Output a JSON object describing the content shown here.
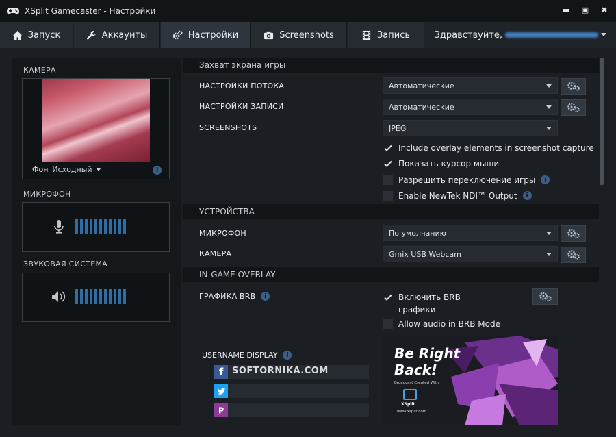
{
  "window": {
    "title": "XSplit Gamecaster - Настройки"
  },
  "tabs": [
    {
      "label": "Запуск",
      "icon": "home-icon"
    },
    {
      "label": "Аккаунты",
      "icon": "wrench-icon"
    },
    {
      "label": "Настройки",
      "icon": "gears-icon"
    },
    {
      "label": "Screenshots",
      "icon": "camera-icon"
    },
    {
      "label": "Запись",
      "icon": "film-icon"
    }
  ],
  "greeting": "Здравствуйте,",
  "left": {
    "camera_label": "КАМЕРА",
    "background_label": "Фон",
    "background_value": "Исходный",
    "mic_label": "МИКРОФОН",
    "speaker_label": "ЗВУКОВАЯ СИСТЕМА"
  },
  "capture": {
    "heading": "Захват экрана игры",
    "stream_label": "НАСТРОЙКИ ПОТОКА",
    "stream_value": "Автоматические",
    "record_label": "НАСТРОЙКИ ЗАПИСИ",
    "record_value": "Автоматические",
    "screenshots_label": "SCREENSHOTS",
    "screenshots_value": "JPEG",
    "checks": [
      {
        "label": "Include overlay elements in screenshot capture",
        "checked": true
      },
      {
        "label": "Показать курсор мыши",
        "checked": true
      },
      {
        "label": "Разрешить переключение игры",
        "checked": false
      },
      {
        "label": "Enable NewTek NDI™ Output",
        "checked": false
      }
    ]
  },
  "devices": {
    "heading": "УСТРОЙСТВА",
    "mic_label": "МИКРОФОН",
    "mic_value": "По умолчанию",
    "camera_label": "КАМЕРА",
    "camera_value": "Gmix USB Webcam"
  },
  "overlay": {
    "heading": "IN-GAME OVERLAY",
    "brb_label": "ГРАФИКА BRB",
    "brb_enable_line1": "Включить BRB",
    "brb_enable_line2": "графики",
    "brb_enable_checked": true,
    "allow_audio_label": "Allow audio in BRB Mode",
    "allow_audio_checked": false,
    "username_label": "USERNAME DISPLAY",
    "facebook_value": "SOFTORNIKA.COM",
    "twitter_value": "",
    "picarto_value": ""
  },
  "brb_preview": {
    "title_line1": "Be Right",
    "title_line2": "Back!",
    "subtitle": "Broadcast Created With",
    "brand": "XSplit",
    "url": "www.xsplit.com"
  },
  "colors": {
    "accent": "#2e6ea6",
    "background": "#1b1f24",
    "panel": "#15181b",
    "brb_purple": "#b05cc8"
  }
}
